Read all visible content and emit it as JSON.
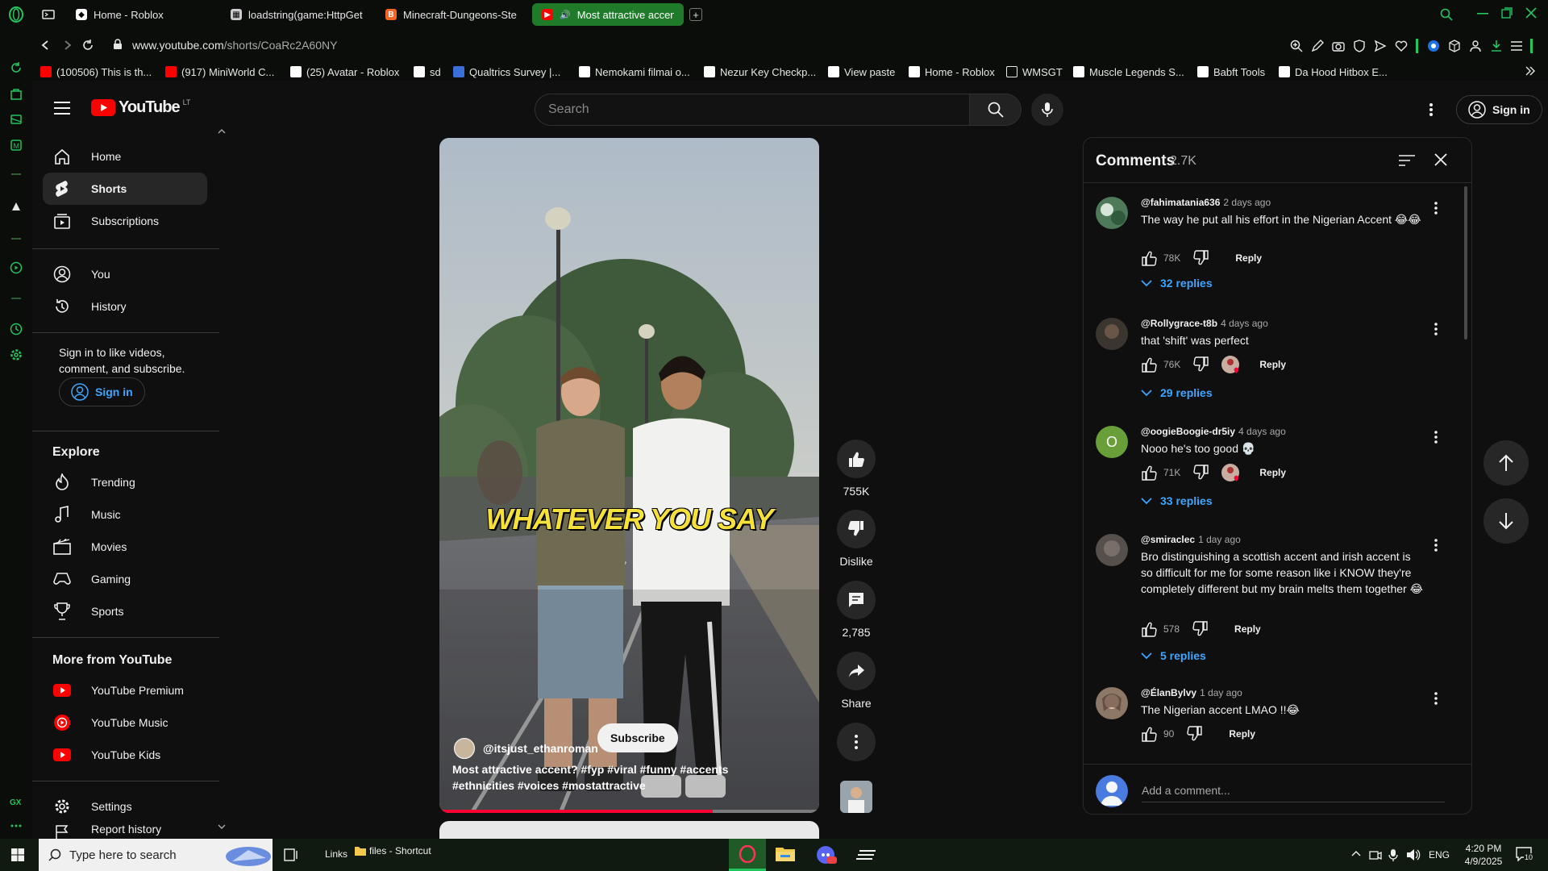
{
  "browser": {
    "tabs": [
      {
        "label": "Home - Roblox",
        "fav_color": "#ffffff"
      },
      {
        "label": "loadstring(game:HttpGet(",
        "fav_color": "#cccccc"
      },
      {
        "label": "Minecraft-Dungeons-Ste",
        "fav_color": "#f26522"
      },
      {
        "label": "Most attractive accent",
        "fav_color": "#ff0000"
      }
    ],
    "url_base": "www.youtube.com",
    "url_path": "/shorts/CoaRc2A60NY",
    "bookmarks": [
      {
        "label": "(100506) This is th...",
        "color": "#ff0000"
      },
      {
        "label": "(917) MiniWorld C...",
        "color": "#ff0000"
      },
      {
        "label": "(25) Avatar - Roblox",
        "color": "#ffffff"
      },
      {
        "label": "sd",
        "color": "#ffffff"
      },
      {
        "label": "Qualtrics Survey |...",
        "color": "#3b6fd8"
      },
      {
        "label": "Nemokami filmai o...",
        "color": "#ffffff"
      },
      {
        "label": "Nezur Key Checkp...",
        "color": "#ffffff"
      },
      {
        "label": "View paste",
        "color": "#ffffff"
      },
      {
        "label": "Home - Roblox",
        "color": "#ffffff"
      },
      {
        "label": "WMSGT",
        "color": "#ffffff"
      },
      {
        "label": "Muscle Legends S...",
        "color": "#ffffff"
      },
      {
        "label": "Babft Tools",
        "color": "#ffffff"
      },
      {
        "label": "Da Hood Hitbox E...",
        "color": "#ffffff"
      }
    ],
    "accent": "#22c55e"
  },
  "youtube": {
    "logo_text": "YouTube",
    "region": "LT",
    "search_placeholder": "Search",
    "signin_label": "Sign in",
    "sidebar": {
      "main": [
        {
          "label": "Home",
          "icon": "home-icon"
        },
        {
          "label": "Shorts",
          "icon": "shorts-icon"
        },
        {
          "label": "Subscriptions",
          "icon": "subscriptions-icon"
        }
      ],
      "you": [
        {
          "label": "You",
          "icon": "you-icon"
        },
        {
          "label": "History",
          "icon": "history-icon"
        }
      ],
      "signin_prompt": "Sign in to like videos, comment, and subscribe.",
      "signin_label": "Sign in",
      "explore_heading": "Explore",
      "explore": [
        {
          "label": "Trending",
          "icon": "trending-icon"
        },
        {
          "label": "Music",
          "icon": "music-icon"
        },
        {
          "label": "Movies",
          "icon": "movies-icon"
        },
        {
          "label": "Gaming",
          "icon": "gaming-icon"
        },
        {
          "label": "Sports",
          "icon": "sports-icon"
        }
      ],
      "more_heading": "More from YouTube",
      "more": [
        {
          "label": "YouTube Premium",
          "icon": "youtube-premium-icon"
        },
        {
          "label": "YouTube Music",
          "icon": "youtube-music-icon"
        },
        {
          "label": "YouTube Kids",
          "icon": "youtube-kids-icon"
        }
      ],
      "settings": {
        "label": "Settings",
        "icon": "settings-icon"
      },
      "report": {
        "label": "Report history",
        "icon": "report-icon"
      }
    },
    "short": {
      "caption": "WHATEVER YOU SAY",
      "channel": "@itsjust_ethanroman",
      "subscribe_label": "Subscribe",
      "description": "Most attractive accent? #fyp #viral #funny #accents #ethnicities #voices #mostattractive",
      "progress": 0.72,
      "likes": "755K",
      "dislike_label": "Dislike",
      "comments_count": "2,785",
      "share_label": "Share"
    },
    "comments_panel": {
      "title": "Comments",
      "count": "2.7K",
      "add_placeholder": "Add a comment...",
      "items": [
        {
          "handle": "@fahimatania636",
          "time": "2 days ago",
          "text": "The way he put all his effort in the Nigerian Accent 😂😂",
          "likes": "78K",
          "reply_label": "Reply",
          "replies": "32 replies",
          "creator_heart": false
        },
        {
          "handle": "@Rollygrace-t8b",
          "time": "4 days ago",
          "text": "that 'shift' was perfect",
          "likes": "76K",
          "reply_label": "Reply",
          "replies": "29 replies",
          "creator_heart": true
        },
        {
          "handle": "@oogieBoogie-dr5iy",
          "time": "4 days ago",
          "text": "Nooo he's too good 💀",
          "likes": "71K",
          "reply_label": "Reply",
          "replies": "33 replies",
          "creator_heart": true,
          "avatar_letter": "O"
        },
        {
          "handle": "@smiraclec",
          "time": "1 day ago",
          "text": "Bro distinguishing a scottish accent and irish accent is so difficult for me for some reason like i KNOW they're completely different but my brain melts them together 😂",
          "likes": "578",
          "reply_label": "Reply",
          "replies": "5 replies",
          "creator_heart": false
        },
        {
          "handle": "@ÉlanBylvy",
          "time": "1 day ago",
          "text": "The Nigerian accent LMAO !!😂",
          "likes": "90",
          "reply_label": "Reply",
          "replies": "",
          "creator_heart": false
        }
      ]
    }
  },
  "taskbar": {
    "search_placeholder": "Type here to search",
    "links_label": "Links",
    "shortcut_label": "files - Shortcut",
    "language": "ENG",
    "time": "4:20 PM",
    "date": "4/9/2025",
    "notifications": "10"
  }
}
